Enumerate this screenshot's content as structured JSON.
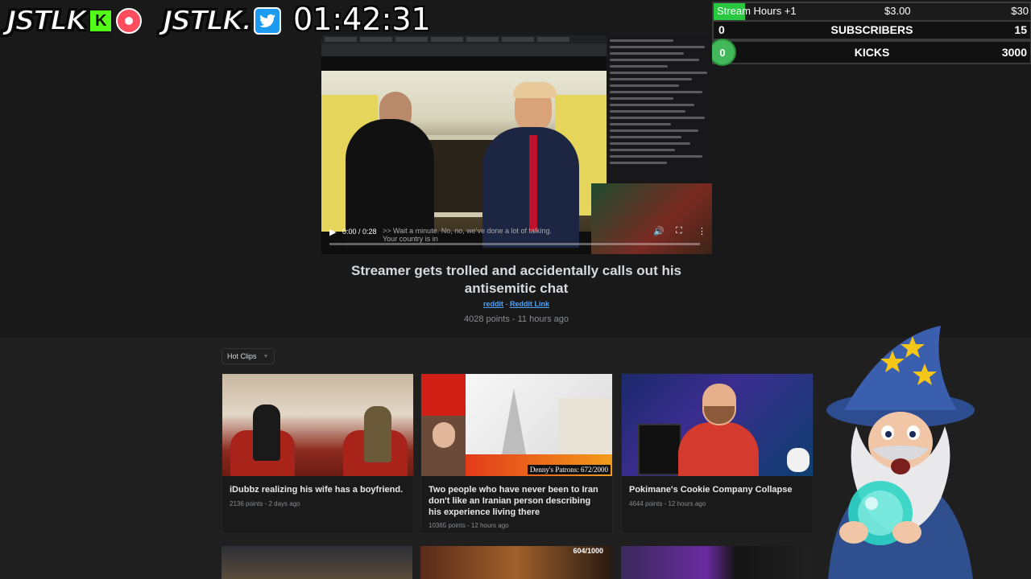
{
  "overlay": {
    "logo_left": "JSTLK",
    "logo_left_badge": "K",
    "logo_right": "JSTLK.",
    "timer": "01:42:31"
  },
  "goals": {
    "stream_hours": {
      "label": "Stream Hours +1",
      "current": "$3.00",
      "max": "$30",
      "progress": 0.1
    },
    "subscribers": {
      "min": "0",
      "label": "SUBSCRIBERS",
      "max": "15"
    },
    "kicks": {
      "min": "0",
      "label": "KICKS",
      "max": "3000"
    }
  },
  "video": {
    "time": "0:00 / 0:28",
    "caption": ">> Wait a minute. No, no, we've done a lot of talking. Your country is in",
    "progress": 0.0
  },
  "post": {
    "title": "Streamer gets trolled and accidentally calls out his antisemitic chat",
    "link1": "reddit",
    "separator": " - ",
    "link2": "Reddit Link",
    "meta": "4028 points - 11 hours ago"
  },
  "filter": {
    "selected": "Hot Clips"
  },
  "cards": [
    {
      "title": "iDubbz realizing his wife has a boyfriend.",
      "meta": "2136 points - 2 days ago"
    },
    {
      "title": "Two people who have never been to Iran don't like an Iranian person describing his experience living there",
      "meta": "10365 points - 12 hours ago",
      "overlay_text": "Denny's Patrons: 672/2000"
    },
    {
      "title": "Pokimane's Cookie Company Collapse",
      "meta": "4644 points - 12 hours ago"
    }
  ],
  "row2_cards": [
    {
      "overlay_text": "604/1000"
    },
    {},
    {}
  ],
  "colors": {
    "accent_green": "#53fc18",
    "link_blue": "#4fa3f7",
    "background": "#1a1a1b"
  }
}
